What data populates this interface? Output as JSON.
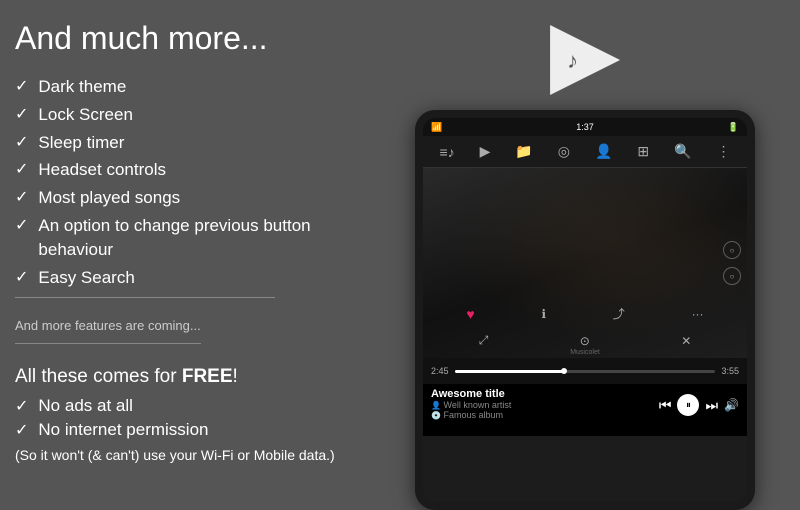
{
  "left": {
    "main_title": "And much more...",
    "features": [
      "Dark theme",
      "Lock Screen",
      "Sleep timer",
      "Headset controls",
      "Most played songs",
      "An option to change previous button behaviour",
      "Easy Search"
    ],
    "coming_soon": "And more features are coming...",
    "free_title_prefix": "All these comes for ",
    "free_title_bold": "FREE",
    "free_title_suffix": "!",
    "free_features": [
      "No ads at all",
      "No internet permission"
    ],
    "wifi_note": "(So it won't (& can't) use your Wi-Fi or Mobile data.)"
  },
  "right": {
    "logo_name": "Musicolet",
    "status": {
      "time": "1:37",
      "icons": "📶🔋"
    },
    "player": {
      "song_title": "Awesome title",
      "artist": "Well known artist",
      "album": "Famous album",
      "time_elapsed": "2:45",
      "time_total": "3:55",
      "progress": 42
    }
  }
}
